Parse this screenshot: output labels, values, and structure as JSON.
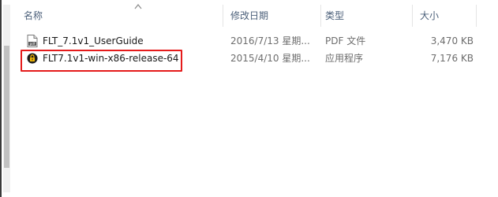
{
  "columns": {
    "name": "名称",
    "modified": "修改日期",
    "type": "类型",
    "size": "大小"
  },
  "files": [
    {
      "name": "FLT_7.1v1_UserGuide",
      "modified": "2016/7/13 星期...",
      "type": "PDF 文件",
      "size": "3,470 KB",
      "icon": "pdf-file-icon"
    },
    {
      "name": "FLT7.1v1-win-x86-release-64",
      "modified": "2015/4/10 星期...",
      "type": "应用程序",
      "size": "7,176 KB",
      "icon": "lock-app-icon"
    }
  ],
  "colors": {
    "highlight": "#e51b1b",
    "header_text": "#4c607a"
  }
}
